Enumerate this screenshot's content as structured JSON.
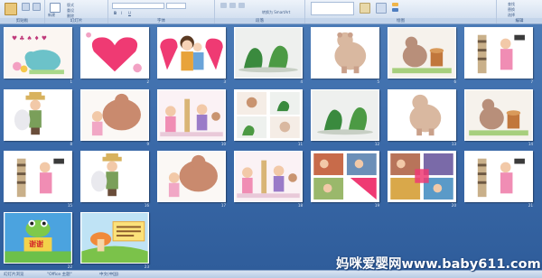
{
  "ribbon": {
    "groups": [
      "剪贴板",
      "幻灯片",
      "字体",
      "段落",
      "绘图",
      "编辑"
    ],
    "items": {
      "new_slide": "新建",
      "layout": "版式",
      "reset": "重设",
      "delete": "删除",
      "find": "查找",
      "replace": "替换",
      "select": "选择",
      "smartart": "转换为 SmartArt"
    }
  },
  "slides": [
    {
      "n": "1"
    },
    {
      "n": "2"
    },
    {
      "n": "3"
    },
    {
      "n": "4"
    },
    {
      "n": "5"
    },
    {
      "n": "6"
    },
    {
      "n": "7"
    },
    {
      "n": "8"
    },
    {
      "n": "9"
    },
    {
      "n": "10"
    },
    {
      "n": "11"
    },
    {
      "n": "12"
    },
    {
      "n": "13"
    },
    {
      "n": "14"
    },
    {
      "n": "15"
    },
    {
      "n": "16"
    },
    {
      "n": "17"
    },
    {
      "n": "18"
    },
    {
      "n": "19"
    },
    {
      "n": "20"
    },
    {
      "n": "21"
    },
    {
      "n": "22"
    },
    {
      "n": "23"
    }
  ],
  "slide_text": {
    "thanks": "谢谢"
  },
  "status": {
    "view": "幻灯片浏览",
    "theme": "\"Office 主题\"",
    "language": "中文(中国)"
  },
  "watermark": "妈咪爱婴网www.baby611.com"
}
